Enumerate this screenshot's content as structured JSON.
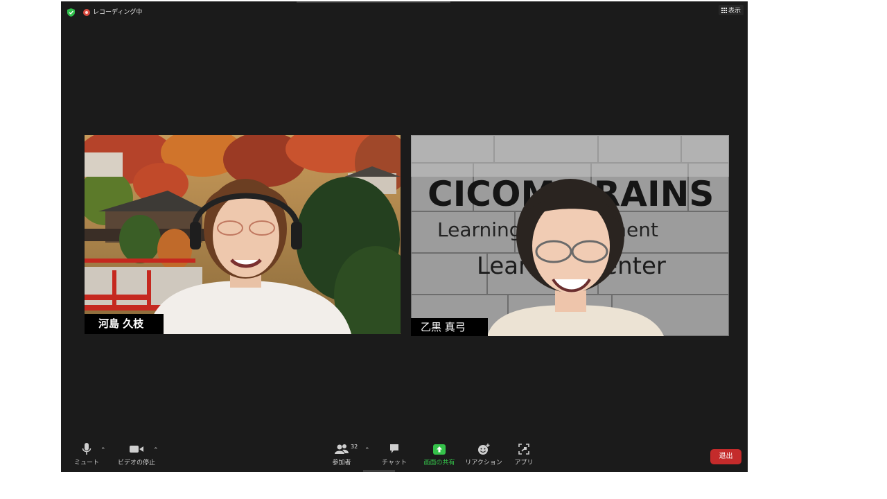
{
  "top_bar": {
    "recording_label": "レコーディング中",
    "view_label": "表示"
  },
  "participants": [
    {
      "name": "河島 久枝"
    },
    {
      "name": "乙黒 真弓"
    }
  ],
  "right_video": {
    "sign_line1": "CICOM BRAINS",
    "sign_line2": "Learning Development",
    "sign_line3": "Learning Center"
  },
  "toolbar": {
    "mute_label": "ミュート",
    "video_label": "ビデオの停止",
    "participants_label": "参加者",
    "participants_count": "32",
    "chat_label": "チャット",
    "share_label": "画面の共有",
    "reactions_label": "リアクション",
    "apps_label": "アプリ",
    "leave_label": "退出"
  },
  "colors": {
    "background": "#1b1b1b",
    "share_green": "#35c24a",
    "leave_red": "#c42b2b",
    "recording_red": "#d94a3f"
  },
  "icons": [
    "shield-icon",
    "record-icon",
    "grid-icon",
    "microphone-icon",
    "camera-icon",
    "participants-icon",
    "chat-icon",
    "share-screen-icon",
    "reaction-icon",
    "apps-icon"
  ]
}
